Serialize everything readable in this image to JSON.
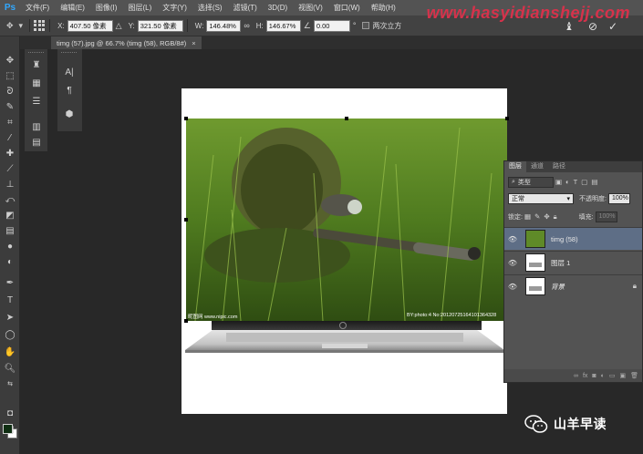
{
  "app": {
    "logo": "Ps"
  },
  "menu": [
    "文件(F)",
    "编辑(E)",
    "图像(I)",
    "图层(L)",
    "文字(Y)",
    "选择(S)",
    "滤镜(T)",
    "3D(D)",
    "视图(V)",
    "窗口(W)",
    "帮助(H)"
  ],
  "watermark": {
    "url": "www.hasyidianshejj.com"
  },
  "options": {
    "x_label": "X:",
    "x_value": "407.50 像素",
    "y_label": "Y:",
    "y_value": "321.50 像素",
    "w_label": "W:",
    "w_value": "146.48%",
    "h_label": "H:",
    "h_value": "146.67%",
    "angle_value": "0.00",
    "interp_label": "两次立方"
  },
  "document": {
    "tab_title": "timg (57).jpg @ 66.7% (timg (58), RGB/8#)",
    "close": "×"
  },
  "photo": {
    "caption_left": "昵图网 www.nipic.com",
    "caption_right": "BY:photo:4 No:20120725164101364328"
  },
  "colors": {
    "foreground": "#0f2e12",
    "background": "#ffffff",
    "selection": "#5e6e86"
  },
  "layers_panel": {
    "tabs": [
      "图层",
      "通道",
      "路径"
    ],
    "filter_label": "类型",
    "blend_mode": "正常",
    "opacity_label": "不透明度:",
    "opacity_value": "100%",
    "lock_label": "锁定:",
    "fill_label": "填充:",
    "fill_value": "100%",
    "layers": [
      {
        "name": "timg (58)",
        "selected": true,
        "italic": false,
        "locked": false
      },
      {
        "name": "图层 1",
        "selected": false,
        "italic": false,
        "locked": false
      },
      {
        "name": "背景",
        "selected": false,
        "italic": true,
        "locked": true
      }
    ]
  },
  "brand": {
    "name": "山羊早读"
  },
  "icons": {
    "tools": [
      "move-icon",
      "marquee-icon",
      "lasso-icon",
      "quick-select-icon",
      "crop-icon",
      "eyedropper-icon",
      "healing-brush-icon",
      "brush-icon",
      "clone-stamp-icon",
      "history-brush-icon",
      "eraser-icon",
      "gradient-icon",
      "blur-icon",
      "dodge-icon",
      "pen-icon",
      "type-icon",
      "path-select-icon",
      "shape-icon",
      "hand-icon",
      "zoom-icon"
    ]
  }
}
